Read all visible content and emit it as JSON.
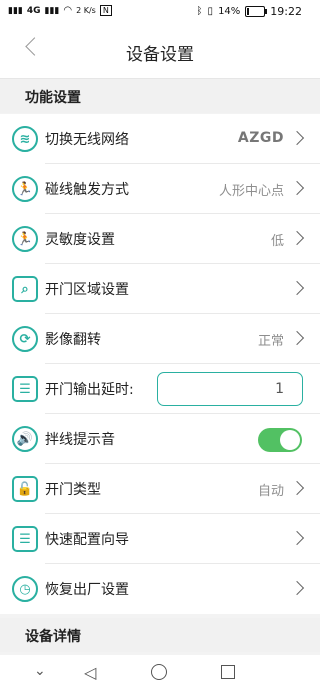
{
  "status": {
    "left_signal": "4G",
    "net_speed": "2 K/s",
    "battery": "14%",
    "battery_level": 0.14,
    "time": "19:22"
  },
  "header": {
    "title": "设备设置"
  },
  "sections": {
    "function": "功能设置",
    "details": "设备详情"
  },
  "rows": [
    {
      "label": "切换无线网络",
      "value": "AZGD",
      "icon": "wifi-icon"
    },
    {
      "label": "碰线触发方式",
      "value": "人形中心点",
      "icon": "runner-icon"
    },
    {
      "label": "灵敏度设置",
      "value": "低",
      "icon": "sensitivity-icon"
    },
    {
      "label": "开门区域设置",
      "value": "",
      "icon": "door-area-icon"
    },
    {
      "label": "影像翻转",
      "value": "正常",
      "icon": "rotate-icon"
    },
    {
      "label": "开门输出延时:",
      "value": "1",
      "icon": "list-icon"
    },
    {
      "label": "拌线提示音",
      "value": "",
      "icon": "speaker-icon",
      "toggle_on": true
    },
    {
      "label": "开门类型",
      "value": "自动",
      "icon": "lock-icon"
    },
    {
      "label": "快速配置向导",
      "value": "",
      "icon": "guide-icon"
    },
    {
      "label": "恢复出厂设置",
      "value": "",
      "icon": "clock-icon"
    }
  ]
}
